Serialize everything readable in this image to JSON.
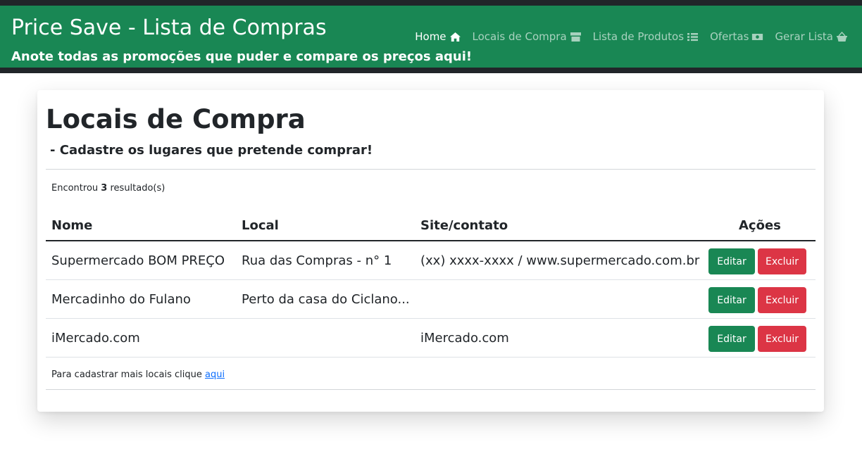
{
  "header": {
    "title": "Price Save - Lista de Compras",
    "subtitle": "Anote todas as promoções que puder e compare os preços aqui!"
  },
  "nav": [
    {
      "label": "Home",
      "icon": "home-icon",
      "active": true
    },
    {
      "label": "Locais de Compra",
      "icon": "store-icon",
      "active": false
    },
    {
      "label": "Lista de Produtos",
      "icon": "list-icon",
      "active": false
    },
    {
      "label": "Ofertas",
      "icon": "money-icon",
      "active": false
    },
    {
      "label": "Gerar Lista",
      "icon": "basket-icon",
      "active": false
    }
  ],
  "main": {
    "title": "Locais de Compra",
    "subtitle": "- Cadastre os lugares que pretende comprar!",
    "result_prefix": "Encontrou",
    "result_count": "3",
    "result_suffix": "resultado(s)",
    "columns": [
      "Nome",
      "Local",
      "Site/contato",
      "Ações"
    ],
    "rows": [
      {
        "nome": "Supermercado BOM PREÇO",
        "local": "Rua das Compras - n° 1",
        "site": "(xx) xxxx-xxxx / www.supermercado.com.br",
        "edit": "Editar",
        "delete": "Excluir"
      },
      {
        "nome": "Mercadinho do Fulano",
        "local": "Perto da casa do Ciclano...",
        "site": "",
        "edit": "Editar",
        "delete": "Excluir"
      },
      {
        "nome": "iMercado.com",
        "local": "",
        "site": "iMercado.com",
        "edit": "Editar",
        "delete": "Excluir"
      }
    ],
    "footer_text": "Para cadastrar mais locais clique",
    "footer_link": "aqui"
  },
  "colors": {
    "header_bg": "#198754",
    "topbar_bg": "#212529",
    "edit_button": "#198754",
    "delete_button": "#dc3545",
    "link": "#0d6efd"
  }
}
